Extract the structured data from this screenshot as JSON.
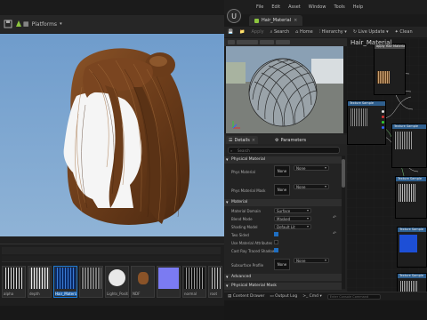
{
  "left_editor": {
    "platforms_label": "Platforms",
    "content_browser": {
      "assets": [
        {
          "label": "alpha"
        },
        {
          "label": "depth"
        },
        {
          "label": "Hair_Material"
        },
        {
          "label": ""
        },
        {
          "label": "Lights_Position"
        },
        {
          "label": "NDF"
        },
        {
          "label": ""
        },
        {
          "label": "normal"
        },
        {
          "label": "root"
        }
      ],
      "selected_index": 2
    }
  },
  "material_editor": {
    "menu": [
      "File",
      "Edit",
      "Asset",
      "Window",
      "Tools",
      "Help"
    ],
    "tab_title": "Hair_Material",
    "toolbar": {
      "save": "Save",
      "apply": "Apply",
      "search": "Search",
      "home": "Home",
      "hierarchy": "Hierarchy",
      "live_update": "Live Update",
      "clean": "Clean"
    },
    "graph_title": "Hair_Material",
    "details": {
      "tab_details": "Details",
      "tab_parameters": "Parameters",
      "search_placeholder": "Search",
      "sections": {
        "physical_material": "Physical Material",
        "material": "Material",
        "advanced": "Advanced",
        "physical_material_mask": "Physical Material Mask"
      },
      "props": {
        "phys_material": "Phys Material",
        "phys_material_mask": "Phys Material Mask",
        "material_domain": "Material Domain",
        "blend_mode": "Blend Mode",
        "shading_model": "Shading Model",
        "two_sided": "Two Sided",
        "use_material_attributes": "Use Material Attributes",
        "cast_ray_traced_shadows": "Cast Ray Traced Shadows",
        "subsurface_profile": "Subsurface Profile"
      },
      "values": {
        "none": "None",
        "material_domain": "Surface",
        "blend_mode": "Masked",
        "shading_model": "Default Lit"
      },
      "checkboxes": {
        "two_sided": true,
        "use_material_attributes": false,
        "cast_ray_traced_shadows": true
      }
    },
    "statusbar": {
      "content_drawer": "Content Drawer",
      "output_log": "Output Log",
      "cmd": "Cmd",
      "console_placeholder": "Enter Console Command"
    },
    "nodes": {
      "texture_sample": "Texture Sample",
      "apply_hair_material": "apply Hair Material"
    }
  }
}
